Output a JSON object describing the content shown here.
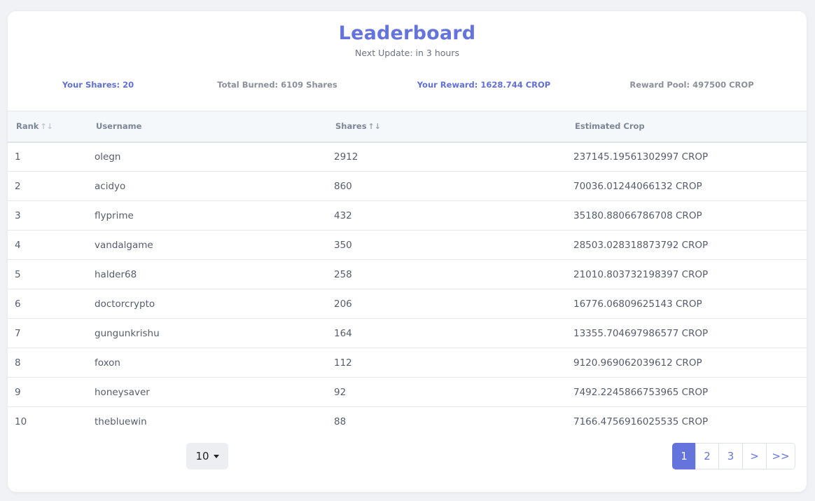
{
  "header": {
    "title": "Leaderboard",
    "subtitle": "Next Update: in 3 hours"
  },
  "stats": [
    {
      "label": "Your Shares: 20",
      "style": "accent"
    },
    {
      "label": "Total Burned: 6109 Shares",
      "style": "muted"
    },
    {
      "label": "Your Reward: 1628.744 CROP",
      "style": "accent"
    },
    {
      "label": "Reward Pool: 497500 CROP",
      "style": "muted"
    }
  ],
  "table": {
    "columns": [
      {
        "label": "Rank",
        "sortable": true
      },
      {
        "label": "Username",
        "sortable": false
      },
      {
        "label": "Shares",
        "sortable": true
      },
      {
        "label": "Estimated Crop",
        "sortable": false
      }
    ],
    "rows": [
      [
        "1",
        "olegn",
        "2912",
        "237145.19561302997 CROP"
      ],
      [
        "2",
        "acidyo",
        "860",
        "70036.01244066132 CROP"
      ],
      [
        "3",
        "flyprime",
        "432",
        "35180.88066786708 CROP"
      ],
      [
        "4",
        "vandalgame",
        "350",
        "28503.028318873792 CROP"
      ],
      [
        "5",
        "halder68",
        "258",
        "21010.803732198397 CROP"
      ],
      [
        "6",
        "doctorcrypto",
        "206",
        "16776.06809625143 CROP"
      ],
      [
        "7",
        "gungunkrishu",
        "164",
        "13355.704697986577 CROP"
      ],
      [
        "8",
        "foxon",
        "112",
        "9120.969062039612 CROP"
      ],
      [
        "9",
        "honeysaver",
        "92",
        "7492.2245866753965 CROP"
      ],
      [
        "10",
        "thebluewin",
        "88",
        "7166.4756916025535 CROP"
      ]
    ]
  },
  "pagination": {
    "page_size": "10",
    "pages": [
      "1",
      "2",
      "3"
    ],
    "next_label": ">",
    "last_label": ">>",
    "current_page": "1"
  },
  "colors": {
    "accent": "#6574dd",
    "muted_text": "#8a8f99",
    "header_bg": "#f5f8fb"
  },
  "icons": {
    "sort": "sort-arrows-icon",
    "dropdown": "caret-down-icon"
  }
}
